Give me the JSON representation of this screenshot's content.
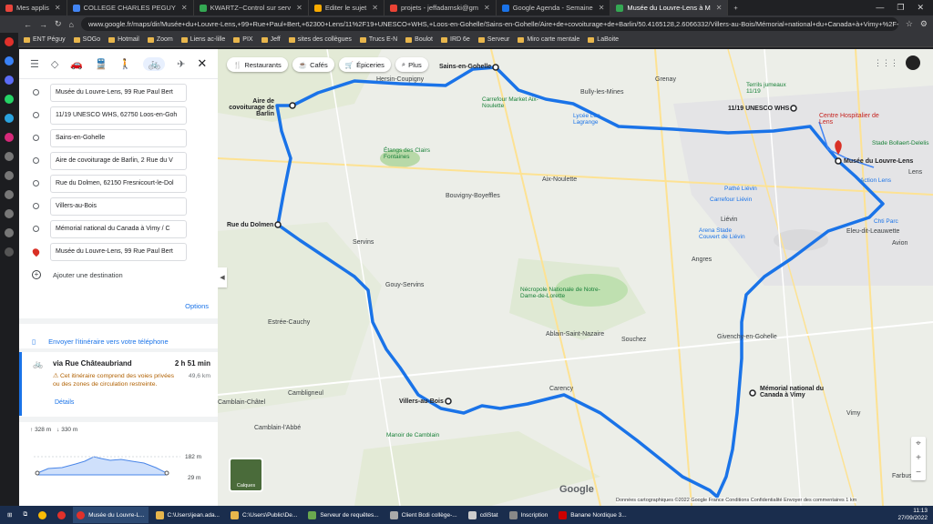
{
  "browser": {
    "tabs": [
      {
        "label": "Mes applis",
        "color": "#e8453c"
      },
      {
        "label": "COLLEGE CHARLES PEGUY",
        "color": "#4285f4"
      },
      {
        "label": "KWARTZ~Control sur serv",
        "color": "#34a853"
      },
      {
        "label": "Editer le sujet",
        "color": "#f9ab00"
      },
      {
        "label": "projets - jeffadamski@gm",
        "color": "#ea4335"
      },
      {
        "label": "Google Agenda - Semaine",
        "color": "#1a73e8"
      },
      {
        "label": "Musée du Louvre-Lens à M",
        "color": "#34a853"
      }
    ],
    "url": "www.google.fr/maps/dir/Musée+du+Louvre-Lens,+99+Rue+Paul+Bert,+62300+Lens/11%2F19+UNESCO+WHS,+Loos-en-Gohelle/Sains-en-Gohelle/Aire+de+covoiturage+de+Barlin/50.4165128,2.6066332/Villers-au-Bois/Mémorial+national+du+Canada+à+Vimy+%2F+Canadian",
    "bookmarks": [
      "ENT Péguy",
      "SOGo",
      "Hotmail",
      "Zoom",
      "Liens ac-lille",
      "PIX",
      "Jeff",
      "sites des collègues",
      "Trucs E-N",
      "Boulot",
      "IRD 6e",
      "Serveur",
      "Miro carte mentale",
      "LaBoite"
    ]
  },
  "directions": {
    "stops": [
      "Musée du Louvre-Lens, 99 Rue Paul Bert",
      "11/19 UNESCO WHS, 62750 Loos-en-Goh",
      "Sains-en-Gohelle",
      "Aire de covoiturage de Barlin, 2 Rue du V",
      "Rue du Dolmen, 62150 Fresnicourt-le-Dol",
      "Villers-au-Bois",
      "Mémorial national du Canada à Vimy / C",
      "Musée du Louvre-Lens, 99 Rue Paul Bert"
    ],
    "add_destination": "Ajouter une destination",
    "options": "Options",
    "send_to_phone": "Envoyer l'itinéraire vers votre téléphone",
    "route": {
      "via": "via Rue Châteaubriand",
      "duration": "2 h 51 min",
      "warning": "Cet itinéraire comprend des voies privées ou des zones de circulation restreinte.",
      "distance": "49,6 km",
      "details": "Détails"
    },
    "elevation": {
      "up": "328 m",
      "down": "330 m",
      "max": "182 m",
      "min": "29 m"
    }
  },
  "map": {
    "chips": [
      "Restaurants",
      "Cafés",
      "Épiceries",
      "Plus"
    ],
    "waypoint_labels": [
      "Sains-en-Gohelle",
      "Aire de covoiturage de Barlin",
      "11/19 UNESCO WHS",
      "Musée du Louvre-Lens",
      "Rue du Dolmen",
      "Villers-au-Bois",
      "Mémorial national du Canada à Vimy"
    ],
    "towns": [
      "Hersin-Coupigny",
      "Bully-les-Mines",
      "Grenay",
      "Lens",
      "Liévin",
      "Angres",
      "Souchez",
      "Givenchy-en-Gohelle",
      "Vimy",
      "Servins",
      "Gouy-Servins",
      "Bouvigny-Boyeffles",
      "Aix-Noulette",
      "Estrée-Cauchy",
      "Camblain-Châtel",
      "Cambligneul",
      "Camblain-l'Abbé",
      "Ablain-Saint-Nazaire",
      "Carency",
      "Avion",
      "Farbus",
      "Eleu-dit-Leauwette"
    ],
    "pois": [
      "Carrefour Market Aix-Noulette",
      "Étangs des Clairs Fontaines",
      "Nécropole Nationale de Notre-Dame-de-Lorette",
      "Carrefour Liévin",
      "Arena Stade Couvert de Liévin",
      "Pathé Liévin",
      "Stade Bollaert-Delelis",
      "Centre Hospitalier de Lens",
      "Terrils jumeaux 11/19",
      "Lycée Léo Lagrange",
      "Manoir de Camblain",
      "Action Lens",
      "Chti Parc"
    ],
    "layers_label": "Calques",
    "google": "Google",
    "footer": "Données cartographiques ©2022 Google   France   Conditions   Confidentialité   Envoyer des commentaires   1 km"
  },
  "taskbar": {
    "items": [
      "Musée du Louvre-L...",
      "C:\\Users\\jean.ada...",
      "C:\\Users\\Public\\De...",
      "Serveur de requêtes...",
      "Client Bcdi collège-...",
      "cdiStat",
      "Inscription",
      "Banane Nordique 3..."
    ],
    "time": "11:13",
    "date": "27/09/2022"
  }
}
